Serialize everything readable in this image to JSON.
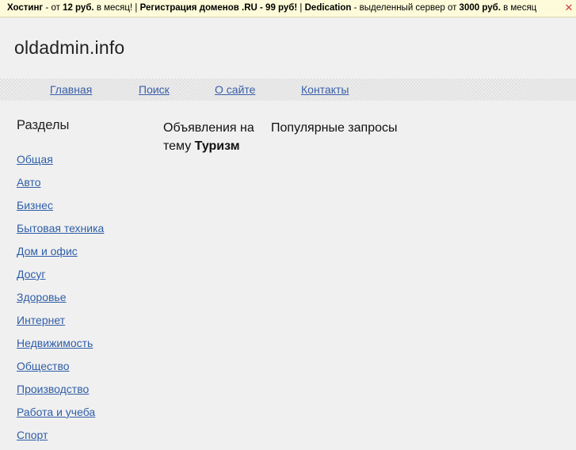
{
  "topbar": {
    "hosting": "Хостинг",
    "from1": " - от ",
    "price1": "12 руб.",
    "per_month1": " в месяц! | ",
    "domains": "Регистрация доменов .RU - 99 руб!",
    "sep": " | ",
    "dedication": "Dedication",
    "dedicated_text": " - выделенный сервер от ",
    "price2": "3000 руб.",
    "per_month2": " в месяц"
  },
  "icons": {
    "close": "close-icon"
  },
  "site": {
    "title": "oldadmin.info"
  },
  "nav": {
    "items": [
      {
        "label": "Главная"
      },
      {
        "label": "Поиск"
      },
      {
        "label": "О сайте"
      },
      {
        "label": "Контакты"
      }
    ]
  },
  "sidebar": {
    "heading": "Разделы",
    "items": [
      {
        "label": "Общая"
      },
      {
        "label": "Авто"
      },
      {
        "label": "Бизнес"
      },
      {
        "label": "Бытовая техника"
      },
      {
        "label": "Дом и офис"
      },
      {
        "label": "Досуг"
      },
      {
        "label": "Здоровье"
      },
      {
        "label": "Интернет"
      },
      {
        "label": "Недвижимость"
      },
      {
        "label": "Общество"
      },
      {
        "label": "Производство"
      },
      {
        "label": "Работа и учеба"
      },
      {
        "label": "Спорт"
      }
    ]
  },
  "main": {
    "ads_prefix": "Объявления на тему ",
    "ads_topic": "Туризм",
    "popular": "Популярные запросы"
  },
  "colors": {
    "link": "#2f5ea8",
    "topbar_bg": "#fdfbd9",
    "page_bg": "#f0f0f0"
  }
}
